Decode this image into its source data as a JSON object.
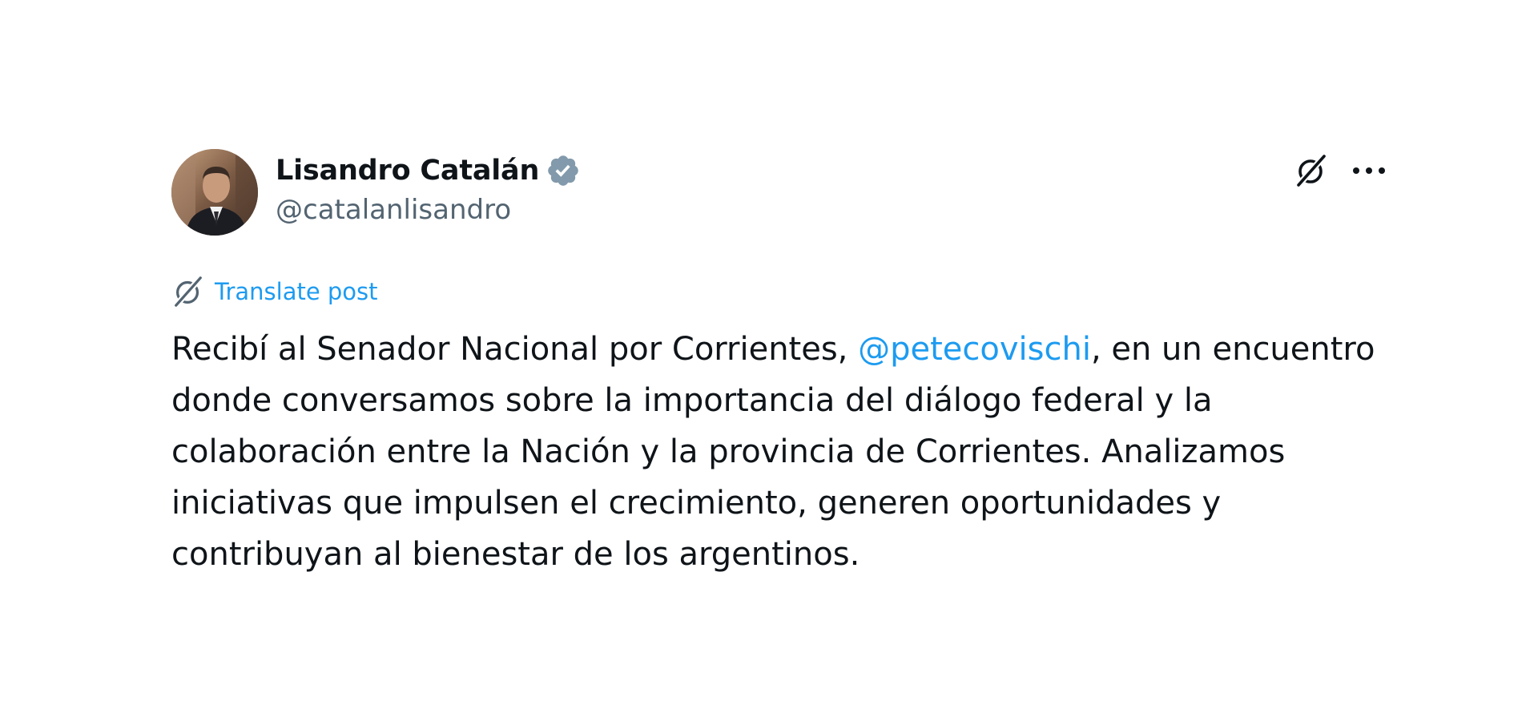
{
  "post": {
    "author": {
      "display_name": "Lisandro Catalán",
      "handle": "@catalanlisandro",
      "verified": true,
      "verified_color": "#829aab"
    },
    "actions": {
      "grok_icon": "grok-icon",
      "more_icon": "more-icon"
    },
    "translate_label": "Translate post",
    "text_parts": {
      "before_mention": "Recibí al Senador Nacional por Corrientes, ",
      "mention": "@petecovischi",
      "after_mention": ", en un encuentro donde conversamos sobre la importancia del diálogo federal y la colaboración entre la Nación y la provincia de Corrientes. Analizamos iniciativas que impulsen el crecimiento, generen oportunidades y contribuyan al bienestar de los argentinos."
    },
    "colors": {
      "text": "#0f1419",
      "secondary": "#536471",
      "link": "#1d9bf0"
    }
  }
}
